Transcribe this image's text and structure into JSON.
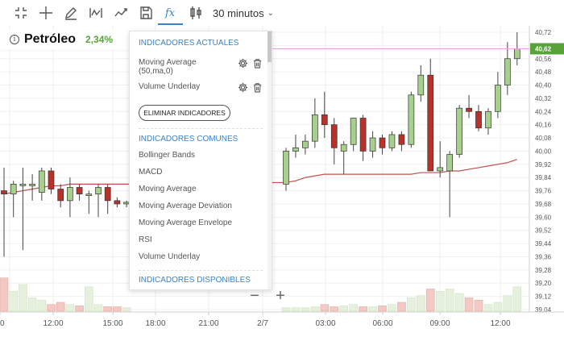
{
  "toolbar": {
    "tools": [
      "fullscreen-icon",
      "crosshair-icon",
      "pencil-icon",
      "wave-icon",
      "trend-icon",
      "save-icon",
      "fx-icon",
      "candle-type-icon"
    ],
    "interval_label": "30 minutos"
  },
  "info": {
    "instrument": "Petróleo",
    "change": "2,34%"
  },
  "panel": {
    "current_title": "INDICADORES ACTUALES",
    "current": [
      {
        "line1": "Moving Average",
        "line2": "(50,ma,0)"
      },
      {
        "line1": "Volume Underlay",
        "line2": ""
      }
    ],
    "remove_label": "ELIMINAR INDICADORES",
    "common_title": "INDICADORES COMUNES",
    "common": [
      "Bollinger Bands",
      "MACD",
      "Moving Average",
      "Moving Average Deviation",
      "Moving Average Envelope",
      "RSI",
      "Volume Underlay"
    ],
    "available_title": "INDICADORES DISPONIBLES"
  },
  "zoom": {
    "minus": "−",
    "plus": "+"
  },
  "colors": {
    "up": "#a8d08d",
    "down": "#b8322a",
    "ma": "#c0504d",
    "accent": "#3b82c4",
    "current_price": "#57a33a"
  },
  "chart_data": {
    "type": "candlestick",
    "y_ticks": [
      "40,72",
      "40,64",
      "40,56",
      "40,48",
      "40,40",
      "40,32",
      "40,24",
      "40,16",
      "40,08",
      "40,00",
      "39,92",
      "39,84",
      "39,76",
      "39,68",
      "39,60",
      "39,52",
      "39,44",
      "39,36",
      "39,28",
      "39,20",
      "39,12",
      "39,04"
    ],
    "x_ticks": [
      "0",
      "12:00",
      "15:00",
      "18:00",
      "21:00",
      "2/7",
      "03:00",
      "06:00",
      "09:00",
      "12:00"
    ],
    "current_price_label": "40,62",
    "ylim": [
      39.0,
      40.76
    ],
    "candles": [
      {
        "o": 39.76,
        "h": 39.9,
        "l": 39.36,
        "c": 39.74
      },
      {
        "o": 39.74,
        "h": 39.82,
        "l": 39.6,
        "c": 39.8
      },
      {
        "o": 39.8,
        "h": 39.9,
        "l": 39.4,
        "c": 39.8
      },
      {
        "o": 39.8,
        "h": 39.86,
        "l": 39.7,
        "c": 39.8
      },
      {
        "o": 39.75,
        "h": 39.9,
        "l": 39.7,
        "c": 39.88
      },
      {
        "o": 39.88,
        "h": 39.9,
        "l": 39.74,
        "c": 39.77
      },
      {
        "o": 39.77,
        "h": 39.8,
        "l": 39.66,
        "c": 39.7
      },
      {
        "o": 39.7,
        "h": 39.84,
        "l": 39.6,
        "c": 39.78
      },
      {
        "o": 39.78,
        "h": 39.8,
        "l": 39.7,
        "c": 39.74
      },
      {
        "o": 39.74,
        "h": 39.76,
        "l": 39.62,
        "c": 39.74
      },
      {
        "o": 39.74,
        "h": 39.8,
        "l": 39.6,
        "c": 39.78
      },
      {
        "o": 39.78,
        "h": 39.8,
        "l": 39.62,
        "c": 39.7
      },
      {
        "o": 39.7,
        "h": 39.72,
        "l": 39.66,
        "c": 39.68
      },
      {
        "o": 39.68,
        "h": 39.7,
        "l": 39.66,
        "c": 39.69
      },
      {
        "o": 39.8,
        "h": 40.02,
        "l": 39.76,
        "c": 40.0
      },
      {
        "o": 40.0,
        "h": 40.1,
        "l": 39.96,
        "c": 40.02
      },
      {
        "o": 40.02,
        "h": 40.1,
        "l": 39.98,
        "c": 40.06
      },
      {
        "o": 40.06,
        "h": 40.32,
        "l": 40.02,
        "c": 40.22
      },
      {
        "o": 40.22,
        "h": 40.36,
        "l": 40.08,
        "c": 40.16
      },
      {
        "o": 40.16,
        "h": 40.2,
        "l": 39.92,
        "c": 40.02
      },
      {
        "o": 40.0,
        "h": 40.06,
        "l": 39.86,
        "c": 40.04
      },
      {
        "o": 40.04,
        "h": 40.2,
        "l": 40.0,
        "c": 40.2
      },
      {
        "o": 40.2,
        "h": 40.22,
        "l": 39.94,
        "c": 40.0
      },
      {
        "o": 40.0,
        "h": 40.12,
        "l": 39.96,
        "c": 40.08
      },
      {
        "o": 40.08,
        "h": 40.1,
        "l": 39.98,
        "c": 40.02
      },
      {
        "o": 40.02,
        "h": 40.12,
        "l": 40.0,
        "c": 40.1
      },
      {
        "o": 40.1,
        "h": 40.12,
        "l": 40.0,
        "c": 40.04
      },
      {
        "o": 40.04,
        "h": 40.36,
        "l": 40.02,
        "c": 40.34
      },
      {
        "o": 40.34,
        "h": 40.52,
        "l": 40.3,
        "c": 40.46
      },
      {
        "o": 40.46,
        "h": 40.56,
        "l": 39.88,
        "c": 39.88
      },
      {
        "o": 39.88,
        "h": 40.06,
        "l": 39.84,
        "c": 39.9
      },
      {
        "o": 39.88,
        "h": 40.0,
        "l": 39.6,
        "c": 39.98
      },
      {
        "o": 39.98,
        "h": 40.28,
        "l": 39.96,
        "c": 40.26
      },
      {
        "o": 40.26,
        "h": 40.34,
        "l": 40.2,
        "c": 40.24
      },
      {
        "o": 40.24,
        "h": 40.28,
        "l": 40.12,
        "c": 40.14
      },
      {
        "o": 40.14,
        "h": 40.26,
        "l": 40.1,
        "c": 40.24
      },
      {
        "o": 40.24,
        "h": 40.48,
        "l": 40.2,
        "c": 40.4
      },
      {
        "o": 40.4,
        "h": 40.66,
        "l": 40.34,
        "c": 40.56
      },
      {
        "o": 40.56,
        "h": 40.72,
        "l": 40.52,
        "c": 40.62
      }
    ],
    "moving_average": [
      39.74,
      39.75,
      39.76,
      39.77,
      39.78,
      39.79,
      39.79,
      39.8,
      39.8,
      39.8,
      39.8,
      39.8,
      39.8,
      39.8,
      39.81,
      39.82,
      39.84,
      39.85,
      39.86,
      39.86,
      39.86,
      39.86,
      39.86,
      39.86,
      39.86,
      39.86,
      39.86,
      39.86,
      39.87,
      39.87,
      39.87,
      39.88,
      39.88,
      39.89,
      39.9,
      39.91,
      39.92,
      39.93,
      39.95
    ],
    "volumes": [
      0.75,
      0.45,
      0.6,
      0.3,
      0.25,
      0.15,
      0.2,
      0.15,
      0.12,
      0.55,
      0.15,
      0.1,
      0.1,
      0.08,
      0.08,
      0.08,
      0.08,
      0.1,
      0.15,
      0.1,
      0.12,
      0.15,
      0.1,
      0.1,
      0.12,
      0.15,
      0.2,
      0.3,
      0.35,
      0.5,
      0.45,
      0.5,
      0.4,
      0.3,
      0.25,
      0.15,
      0.2,
      0.35,
      0.55
    ]
  }
}
